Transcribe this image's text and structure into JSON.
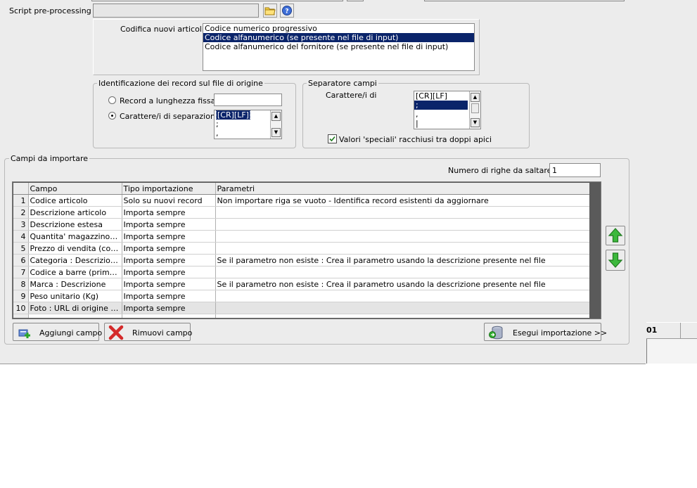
{
  "pre_processing": {
    "label": "Script pre-processing :",
    "value": ""
  },
  "codifica": {
    "label": "Codifica nuovi articoli :",
    "options": [
      "Codice numerico progressivo",
      "Codice alfanumerico (se presente nel file di input)",
      "Codice alfanumerico del fornitore (se presente nel file di input)"
    ],
    "selected_index": 1
  },
  "identificazione": {
    "legend": "Identificazione dei record sul file di origine",
    "radio_fixed_label": "Record a lunghezza fissa",
    "fixed_value": "",
    "radio_sep_label": "Carattere/i di separazione",
    "sep_items": [
      "[CR][LF]",
      ";",
      ","
    ]
  },
  "separatore": {
    "legend": "Separatore campi",
    "label": "Carattere/i di",
    "items": [
      "[CR][LF]",
      ";",
      ",",
      "|"
    ],
    "selected_index": 1,
    "checkbox_label": "Valori 'speciali' racchiusi tra doppi apici",
    "checkbox_checked": true
  },
  "campi": {
    "legend": "Campi da importare",
    "skip_label": "Numero di righe da saltare  :",
    "skip_value": "1",
    "columns": [
      "Campo",
      "Tipo importazione",
      "Parametri"
    ],
    "rows": [
      {
        "n": "1",
        "campo": "Codice articolo",
        "tipo": "Solo su nuovi record",
        "param": "Non importare riga se vuoto - Identifica record esistenti da aggiornare"
      },
      {
        "n": "2",
        "campo": "Descrizione articolo",
        "tipo": "Importa sempre",
        "param": ""
      },
      {
        "n": "3",
        "campo": "Descrizione estesa",
        "tipo": "Importa sempre",
        "param": ""
      },
      {
        "n": "4",
        "campo": "Quantita' magazzino sp...",
        "tipo": "Importa sempre",
        "param": ""
      },
      {
        "n": "5",
        "campo": "Prezzo di vendita (con i...",
        "tipo": "Importa sempre",
        "param": ""
      },
      {
        "n": "6",
        "campo": "Categoria : Descrizione ...",
        "tipo": "Importa sempre",
        "param": "Se il parametro non esiste : Crea il parametro usando la descrizione presente nel file"
      },
      {
        "n": "7",
        "campo": "Codice a barre (primo c...",
        "tipo": "Importa sempre",
        "param": ""
      },
      {
        "n": "8",
        "campo": "Marca : Descrizione",
        "tipo": "Importa sempre",
        "param": "Se il parametro non esiste : Crea il parametro usando la descrizione presente nel file"
      },
      {
        "n": "9",
        "campo": "Peso unitario (Kg)",
        "tipo": "Importa sempre",
        "param": ""
      },
      {
        "n": "10",
        "campo": "Foto : URL di origine pe...",
        "tipo": "Importa sempre",
        "param": ""
      }
    ]
  },
  "buttons": {
    "aggiungi": "Aggiungi campo",
    "rimuovi": "Rimuovi campo",
    "esegui": "Esegui importazione >>"
  },
  "right_panel": {
    "text": "01"
  },
  "colors": {
    "selection": "#0a246a",
    "arrow_green": "#2fa82f",
    "remove_red": "#d42a2a"
  }
}
